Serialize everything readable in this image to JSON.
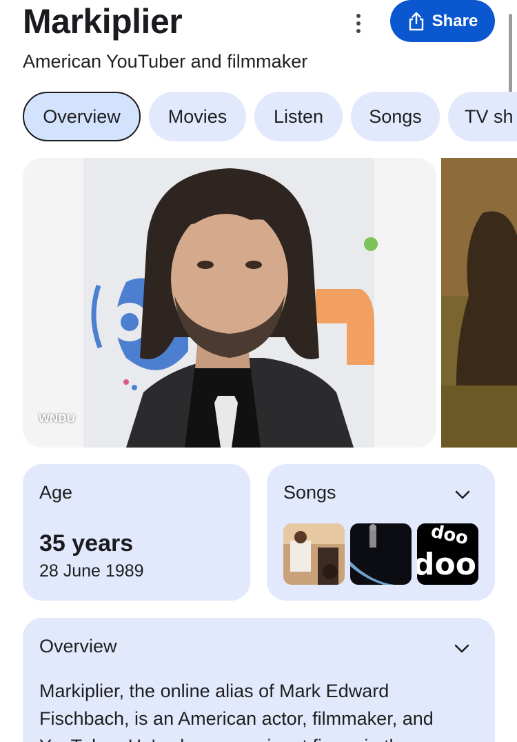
{
  "entity": {
    "title": "Markiplier",
    "subtitle": "American YouTuber and filmmaker"
  },
  "actions": {
    "share_label": "Share"
  },
  "tabs": [
    {
      "label": "Overview"
    },
    {
      "label": "Movies"
    },
    {
      "label": "Listen"
    },
    {
      "label": "Songs"
    },
    {
      "label": "TV sh"
    }
  ],
  "images": {
    "main_credit": "WNDU"
  },
  "age_card": {
    "label": "Age",
    "value": "35 years",
    "date": "28 June 1989"
  },
  "songs_card": {
    "label": "Songs",
    "thumb3_text": "doo"
  },
  "overview_card": {
    "label": "Overview",
    "text": "Markiplier, the online alias of Mark Edward Fischbach, is an American actor, filmmaker, and YouTuber. He's also a prominent figure in the"
  },
  "colors": {
    "accent": "#0b57d0",
    "chip_bg": "#e2e9fc",
    "active_chip_bg": "#d3e3fd"
  }
}
